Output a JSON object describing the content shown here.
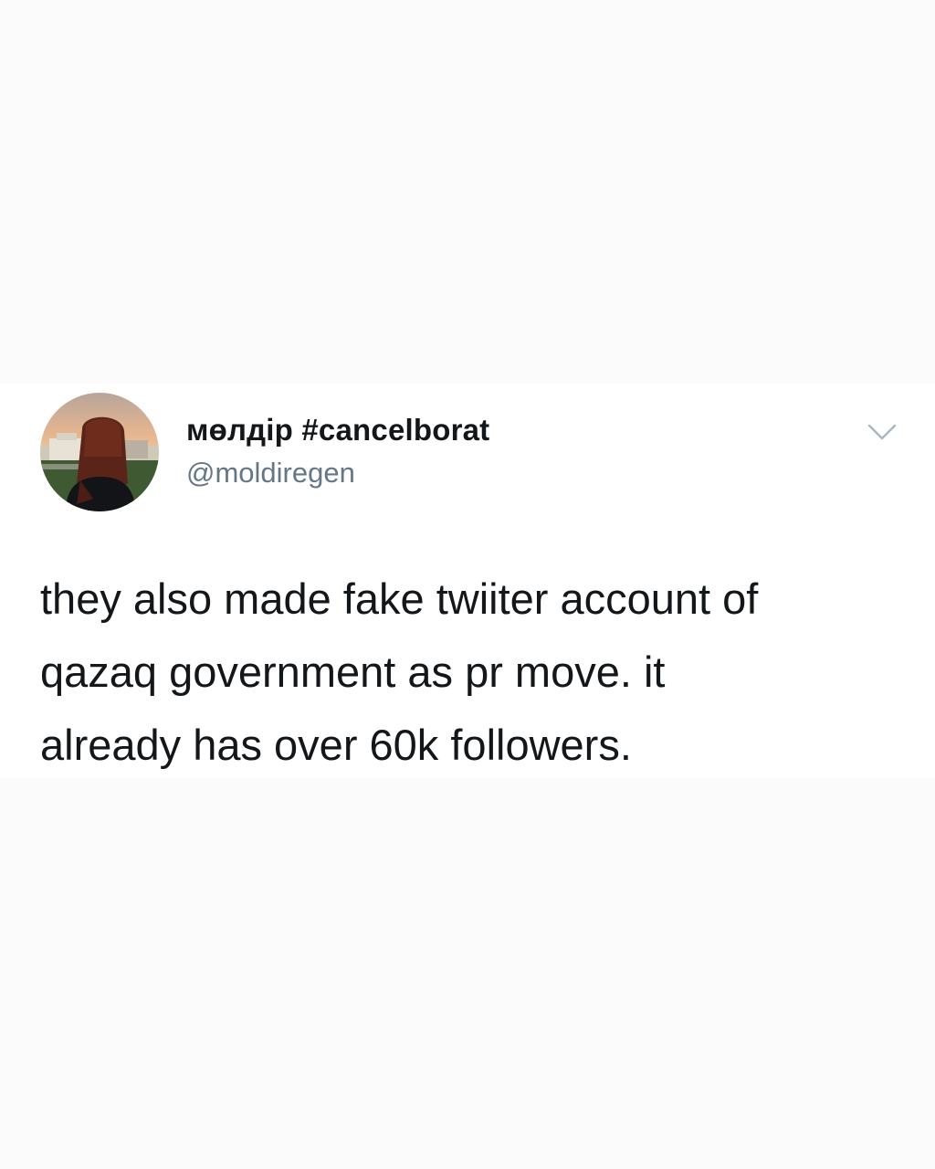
{
  "tweet": {
    "author": {
      "display_name": "мөлдір #cancelborat",
      "handle": "@moldiregen",
      "avatar_icon": "profile-photo"
    },
    "menu_icon": "chevron-down-icon",
    "text_lines": [
      "they also made fake twiiter account of",
      "qazaq government as pr move. it",
      "already has over 60k followers."
    ]
  },
  "colors": {
    "background": "#fcfbfb",
    "card": "#ffffff",
    "text_primary": "#14171a",
    "text_secondary": "#657786"
  }
}
